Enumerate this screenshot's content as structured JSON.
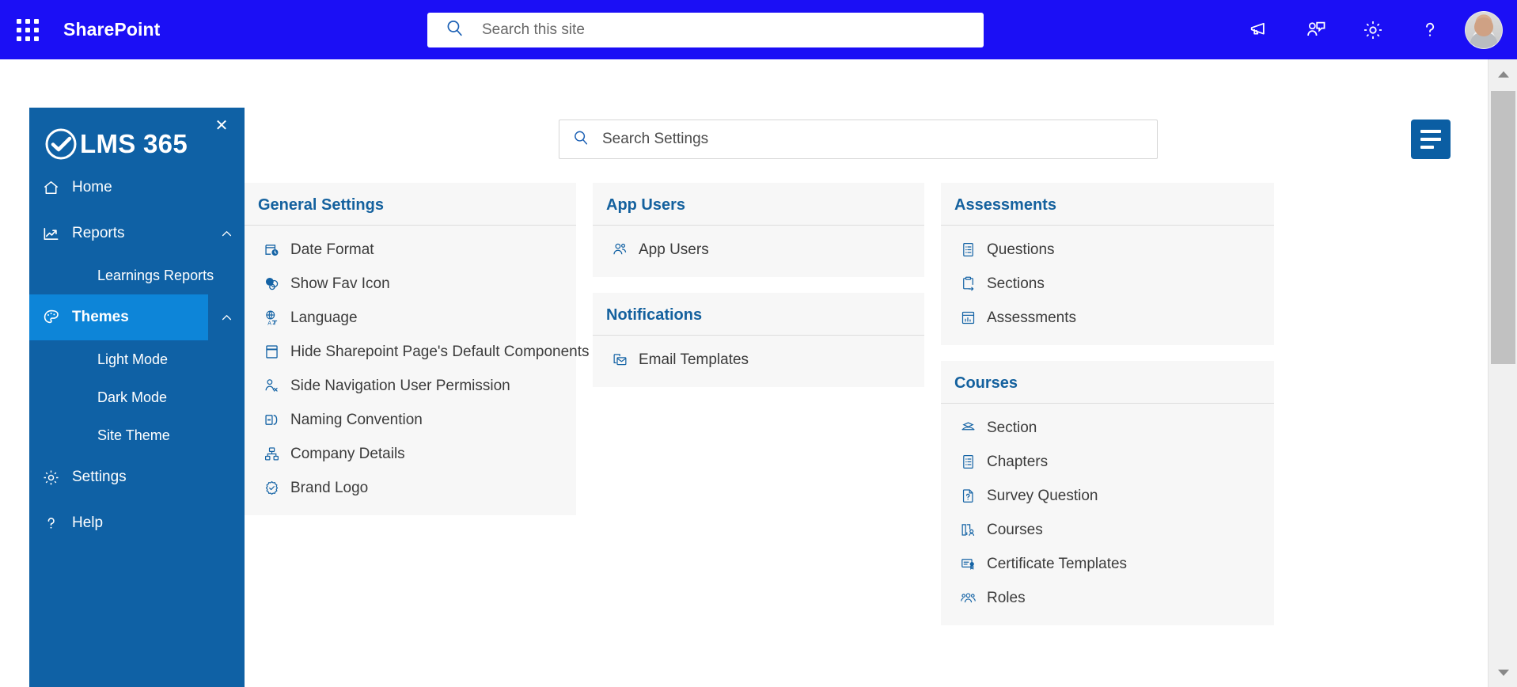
{
  "suite": {
    "waffle_icon": "app-launcher-icon",
    "brand": "SharePoint",
    "search": {
      "icon": "search-icon",
      "placeholder": "Search this site",
      "value": ""
    },
    "actions": [
      {
        "name": "megaphone-icon",
        "label": "Megaphone"
      },
      {
        "name": "feedback-icon",
        "label": "Feedback"
      },
      {
        "name": "gear-icon",
        "label": "Settings"
      },
      {
        "name": "help-icon",
        "label": "?"
      }
    ],
    "avatar": "user-avatar"
  },
  "sidenav": {
    "close_label": "✕",
    "brand": "LMS 365",
    "logo_icon": "lms365-check-logo",
    "items": [
      {
        "label": "Home",
        "icon": "home-icon",
        "type": "item",
        "active": false,
        "expandable": false
      },
      {
        "label": "Reports",
        "icon": "chart-line-icon",
        "type": "item",
        "active": false,
        "expandable": true,
        "chevron": "chevron-up-icon"
      },
      {
        "label": "Learnings Reports",
        "type": "sub"
      },
      {
        "label": "Themes",
        "icon": "palette-icon",
        "type": "item",
        "active": true,
        "expandable": true,
        "chevron": "chevron-up-icon"
      },
      {
        "label": "Light Mode",
        "type": "sub"
      },
      {
        "label": "Dark Mode",
        "type": "sub"
      },
      {
        "label": "Site Theme",
        "type": "sub"
      },
      {
        "label": "Settings",
        "icon": "gear-icon",
        "type": "item",
        "active": false,
        "expandable": false
      },
      {
        "label": "Help",
        "icon": "question-icon",
        "type": "item",
        "active": false,
        "expandable": false
      }
    ]
  },
  "toolbar": {
    "search": {
      "icon": "search-icon",
      "placeholder": "Search Settings",
      "value": ""
    },
    "filter_button": {
      "icon": "menu-lines-icon",
      "label": ""
    }
  },
  "cards": {
    "general_settings": {
      "title": "General Settings",
      "items": [
        {
          "label": "Date Format",
          "icon": "calendar-clock-icon"
        },
        {
          "label": "Show Fav Icon",
          "icon": "sharepoint-favicon-icon"
        },
        {
          "label": "Language",
          "icon": "language-globe-icon"
        },
        {
          "label": "Hide Sharepoint Page's Default Components",
          "icon": "page-layout-icon"
        },
        {
          "label": "Side Navigation User Permission",
          "icon": "user-permission-icon"
        },
        {
          "label": "Naming Convention",
          "icon": "rename-icon"
        },
        {
          "label": "Company Details",
          "icon": "org-hierarchy-icon"
        },
        {
          "label": "Brand Logo",
          "icon": "badge-check-icon"
        }
      ]
    },
    "app_users": {
      "title": "App Users",
      "items": [
        {
          "label": "App Users",
          "icon": "people-icon"
        }
      ]
    },
    "notifications": {
      "title": "Notifications",
      "items": [
        {
          "label": "Email Templates",
          "icon": "mail-template-icon"
        }
      ]
    },
    "assessments": {
      "title": "Assessments",
      "items": [
        {
          "label": "Questions",
          "icon": "list-document-icon"
        },
        {
          "label": "Sections",
          "icon": "clipboard-arrow-icon"
        },
        {
          "label": "Assessments",
          "icon": "report-grid-icon"
        }
      ]
    },
    "courses": {
      "title": "Courses",
      "items": [
        {
          "label": "Section",
          "icon": "stacked-cards-icon"
        },
        {
          "label": "Chapters",
          "icon": "list-document-icon"
        },
        {
          "label": "Survey Question",
          "icon": "question-document-icon"
        },
        {
          "label": "Courses",
          "icon": "book-user-icon"
        },
        {
          "label": "Certificate Templates",
          "icon": "certificate-icon"
        },
        {
          "label": "Roles",
          "icon": "people-group-icon"
        }
      ]
    }
  },
  "colors": {
    "suite_bar": "#1b0ff5",
    "sidenav": "#0f61a5",
    "sidenav_active": "#0d85d8",
    "card_bg": "#f7f7f7",
    "card_title": "#14619e",
    "icon_blue": "#1463a5",
    "filter_button": "#0b5ea3"
  },
  "scrollbar": {
    "up_icon": "arrow-up-icon",
    "down_icon": "arrow-down-icon"
  }
}
